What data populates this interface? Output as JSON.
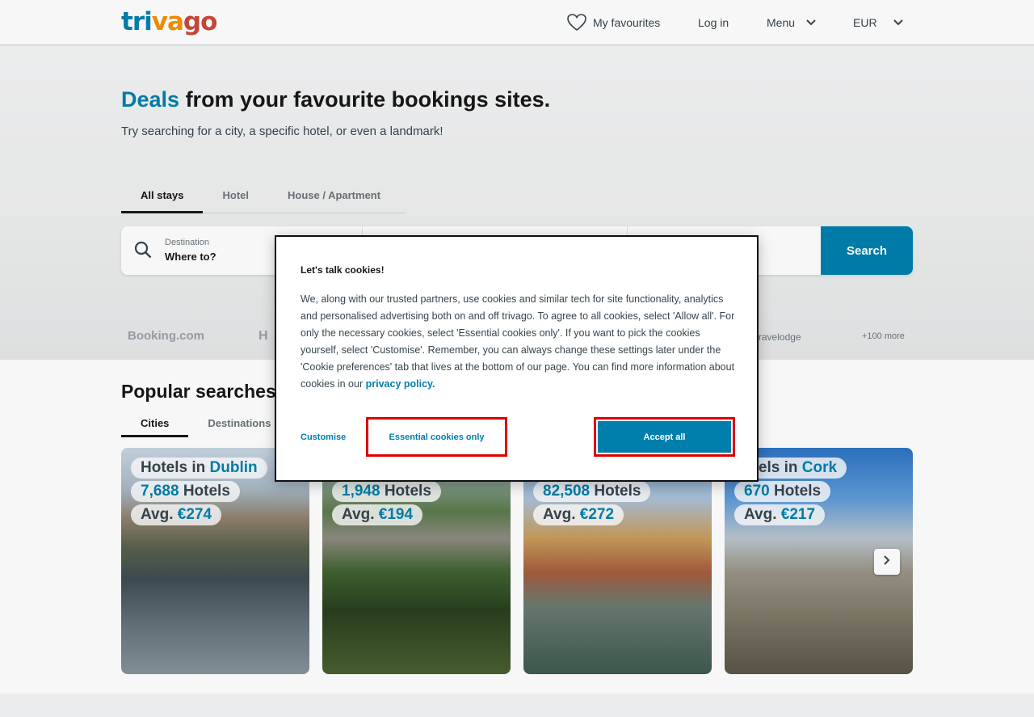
{
  "header": {
    "logo": {
      "part1": "tri",
      "part2": "va",
      "part3": "go"
    },
    "favourites_label": "My favourites",
    "login_label": "Log in",
    "menu_label": "Menu",
    "currency_label": "EUR"
  },
  "hero": {
    "title_accent": "Deals",
    "title_rest": " from your favourite bookings sites.",
    "subtitle": "Try searching for a city, a specific hotel, or even a landmark!",
    "tabs": [
      "All stays",
      "Hotel",
      "House / Apartment"
    ],
    "active_tab": "All stays",
    "destination_label": "Destination",
    "destination_value": "Where to?",
    "search_button": "Search"
  },
  "partners": {
    "booking": "Booking.com",
    "h": "H",
    "travelodge": "Travelodge",
    "more": "+100 more"
  },
  "popular": {
    "title": "Popular searches",
    "tabs": [
      "Cities",
      "Destinations"
    ],
    "active_tab": "Cities",
    "cards": [
      {
        "prefix": "Hotels in ",
        "city": "Dublin",
        "count": "7,688",
        "hotels_label": " Hotels",
        "avg_label": "Avg. ",
        "avg_price": "€274"
      },
      {
        "prefix": "",
        "city": "",
        "count": "1,948",
        "hotels_label": " Hotels",
        "avg_label": "Avg. ",
        "avg_price": "€194"
      },
      {
        "prefix": "",
        "city": "",
        "count": "82,508",
        "hotels_label": " Hotels",
        "avg_label": "Avg. ",
        "avg_price": "€272"
      },
      {
        "prefix": "otels in ",
        "city": "Cork",
        "count": "670",
        "hotels_label": " Hotels",
        "avg_label": "Avg. ",
        "avg_price": "€217"
      }
    ]
  },
  "cookie_dialog": {
    "title": "Let's talk cookies!",
    "body": "We, along with our trusted partners, use cookies and similar tech for site functionality, analytics and personalised advertising both on and off trivago. To agree to all cookies, select 'Allow all'. For only the necessary cookies, select 'Essential cookies only'. If you want to pick the cookies yourself, select 'Customise'. Remember, you can always change these settings later under the 'Cookie preferences' tab that lives at the bottom of our page. You can find more information about cookies in our ",
    "privacy_link": "privacy policy.",
    "customise_label": "Customise",
    "essential_label": "Essential cookies only",
    "accept_label": "Accept all"
  },
  "colors": {
    "brand_blue": "#007fad",
    "highlight_red": "#e00000"
  }
}
